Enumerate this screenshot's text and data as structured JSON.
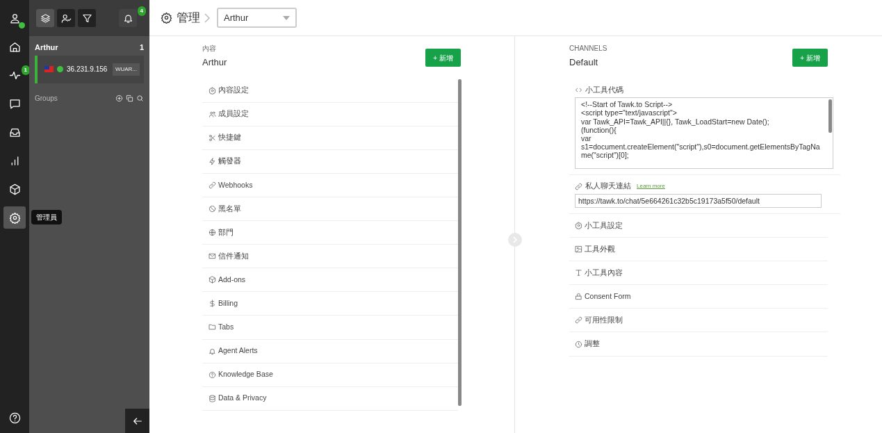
{
  "rail": {
    "items": [
      {
        "selected": false,
        "online": true
      },
      {
        "selected": false
      },
      {
        "selected": false,
        "badge": "1"
      },
      {
        "selected": false
      },
      {
        "selected": false
      },
      {
        "selected": false
      },
      {
        "selected": false
      },
      {
        "selected": true,
        "tooltip": "管理員"
      }
    ]
  },
  "sidebar": {
    "notifications": {
      "badge": "4"
    },
    "group": {
      "name": "Arthur",
      "count": "1",
      "visitors": [
        {
          "ip": "36.231.9.156",
          "online": true,
          "tag": "WUAR..."
        }
      ]
    },
    "groups_label": "Groups"
  },
  "header": {
    "title": "管理",
    "property_select": "Arthur"
  },
  "left": {
    "label": "內容",
    "name": "Arthur",
    "add_button": "+ 新增",
    "items": [
      "內容設定",
      "成員設定",
      "快捷鍵",
      "觸發器",
      "Webhooks",
      "黑名單",
      "部門",
      "信件通知",
      "Add-ons",
      "Billing",
      "Tabs",
      "Agent Alerts",
      "Knowledge Base",
      "Data & Privacy"
    ]
  },
  "right": {
    "label": "CHANNELS",
    "name": "Default",
    "add_button": "+ 新增",
    "widget_code": {
      "title": "小工具代碼",
      "value": "<!--Start of Tawk.to Script-->\n<script type=\"text/javascript\">\nvar Tawk_API=Tawk_API||{}, Tawk_LoadStart=new Date();\n(function(){\nvar\ns1=document.createElement(\"script\"),s0=document.getElementsByTagName(\"script\")[0];"
    },
    "chat_link": {
      "title": "私人聊天連結",
      "learn_more": "Learn more",
      "value": "https://tawk.to/chat/5e664261c32b5c19173a5f50/default"
    },
    "items": [
      "小工具設定",
      "工具外觀",
      "小工具內容",
      "Consent Form",
      "可用性限制",
      "調整"
    ]
  }
}
